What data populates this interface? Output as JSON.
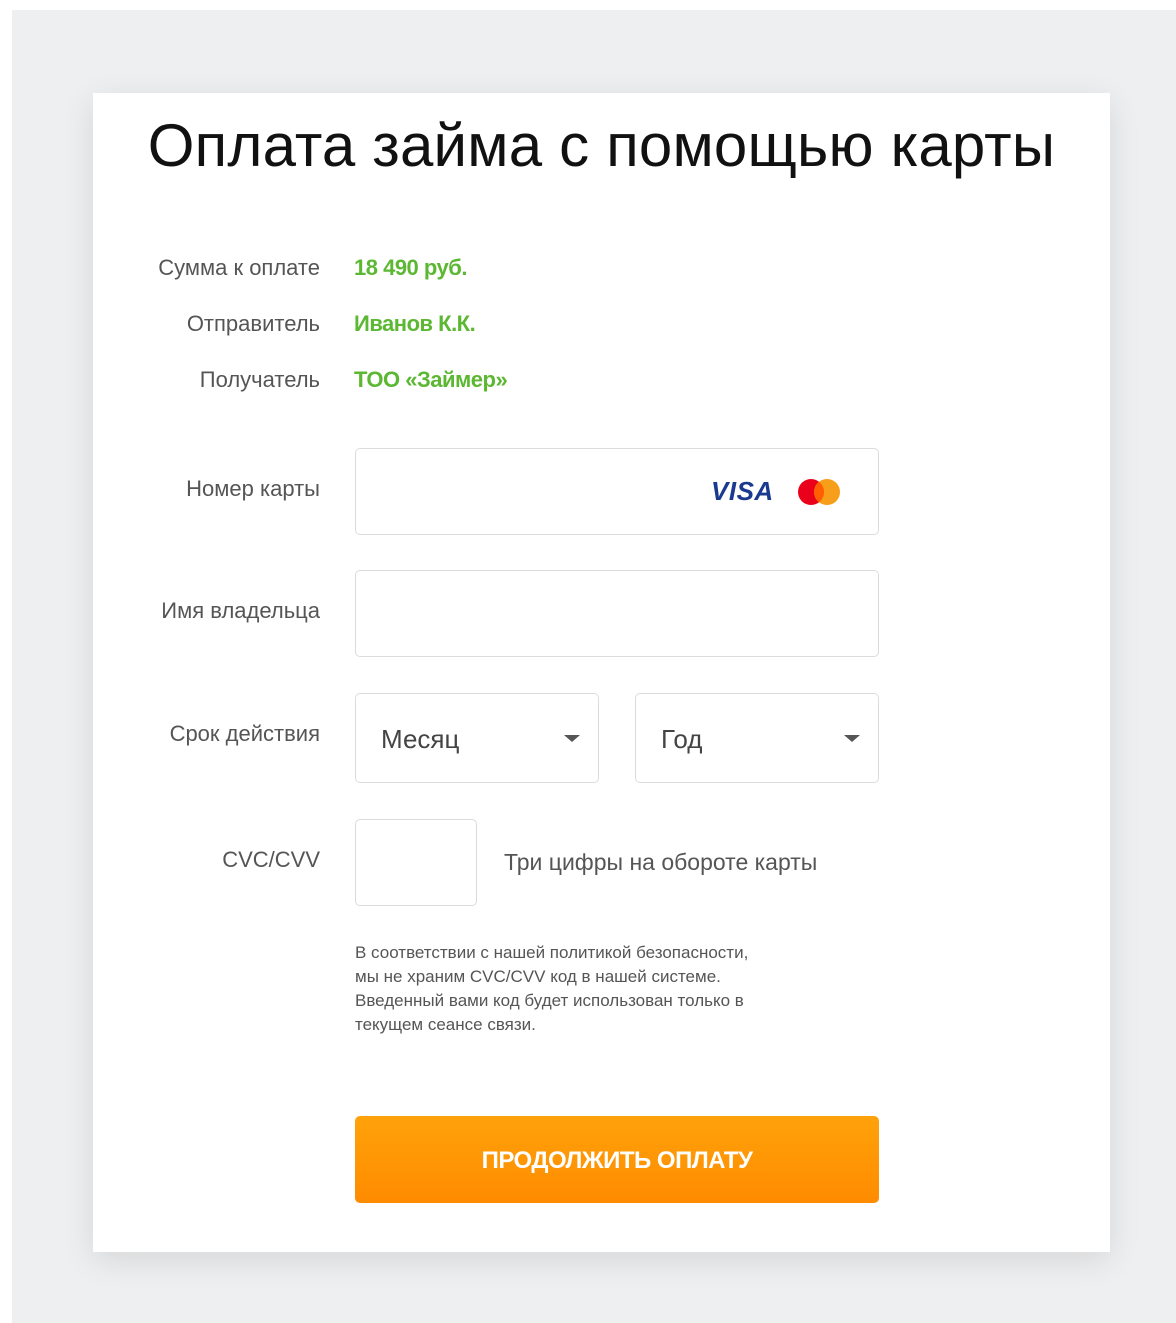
{
  "title": "Оплата займа с помощью карты",
  "summary": {
    "amount_label": "Сумма к оплате",
    "amount_value": "18 490 руб.",
    "sender_label": "Отправитель",
    "sender_value": "Иванов К.К.",
    "recipient_label": "Получатель",
    "recipient_value": "ТОО «Займер»"
  },
  "card_form": {
    "card_number_label": "Номер карты",
    "card_number_value": "",
    "card_brands": [
      "VISA",
      "MasterCard"
    ],
    "holder_label": "Имя владельца",
    "holder_value": "",
    "expiry_label": "Срок действия",
    "month_selected": "Месяц",
    "year_selected": "Год",
    "cvc_label": "CVC/CVV",
    "cvc_value": "",
    "cvc_hint": "Три цифры на обороте карты",
    "security_note_lines": [
      "В соответствии с нашей политикой безопасности,",
      "мы не храним CVC/CVV код в нашей системе.",
      "Введенный вами код будет использован только в",
      "текущем сеансе связи."
    ]
  },
  "submit_label": "ПРОДОЛЖИТЬ ОПЛАТУ",
  "colors": {
    "accent_green": "#5cb832",
    "button_orange": "#ff9500",
    "visa_blue": "#1a3a8f",
    "mastercard_red": "#eb001b",
    "mastercard_yellow": "#f79e1b"
  },
  "icons": {
    "dropdown": "chevron-down-icon",
    "visa": "visa-logo",
    "mastercard": "mastercard-logo"
  }
}
